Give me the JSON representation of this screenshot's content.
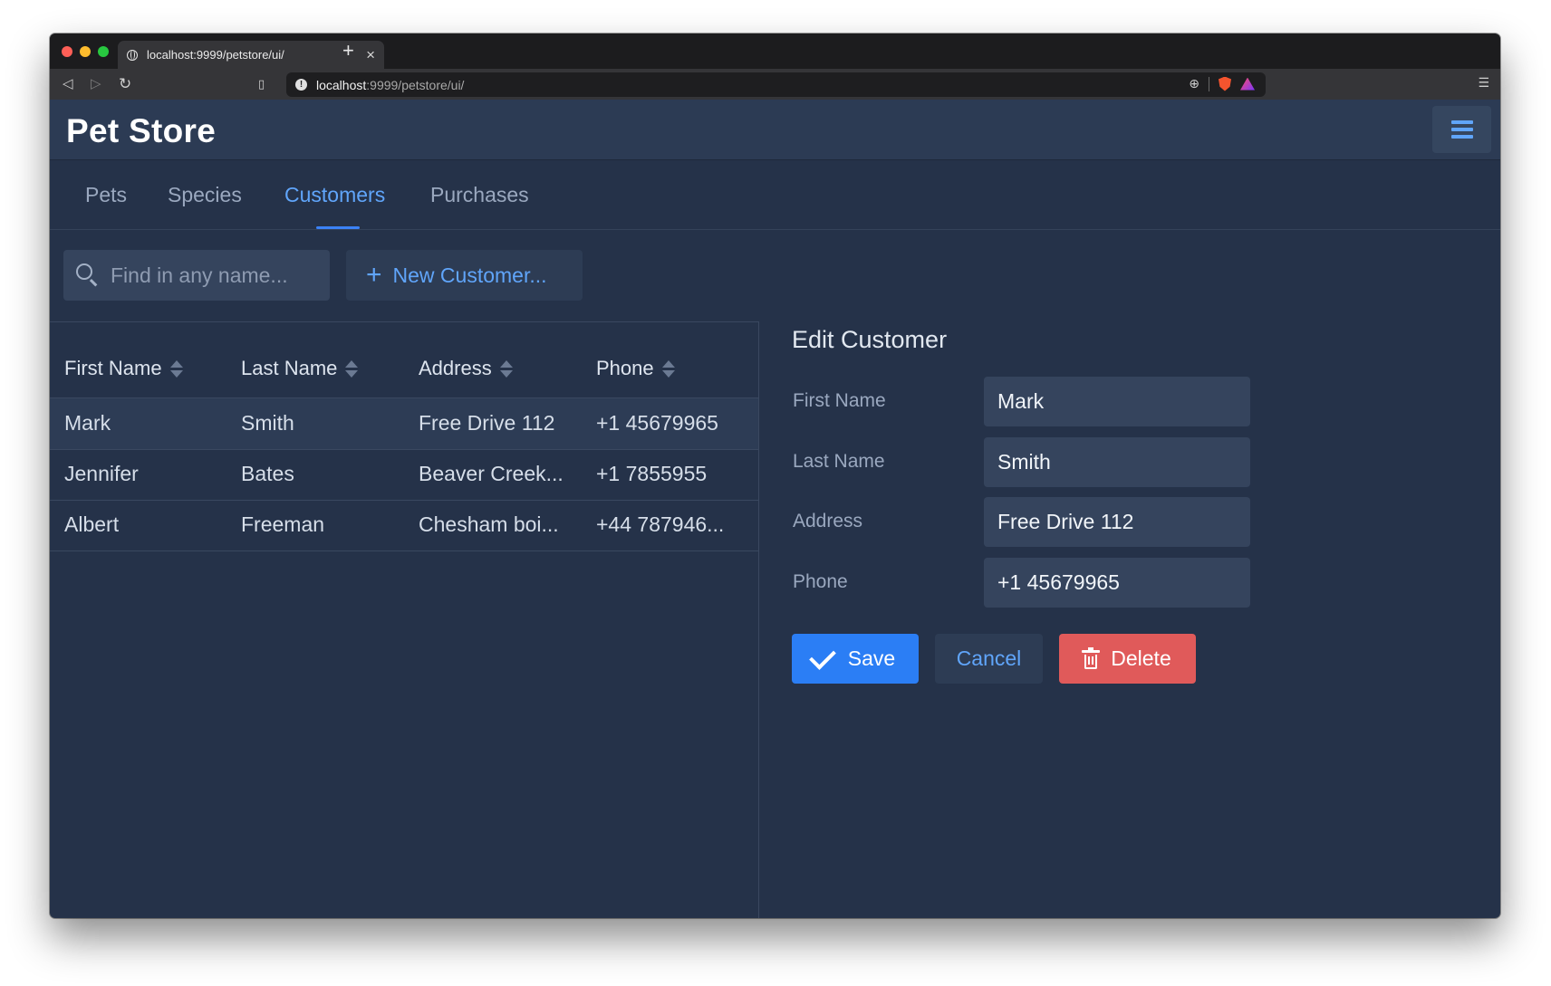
{
  "browser": {
    "tab_title": "localhost:9999/petstore/ui/",
    "tab_close": "×",
    "new_tab": "+",
    "url_host": "localhost",
    "url_rest": ":9999/petstore/ui/"
  },
  "app": {
    "title": "Pet Store"
  },
  "nav": {
    "tabs": [
      {
        "label": "Pets",
        "active": false
      },
      {
        "label": "Species",
        "active": false
      },
      {
        "label": "Customers",
        "active": true
      },
      {
        "label": "Purchases",
        "active": false
      }
    ]
  },
  "search": {
    "placeholder": "Find in any name...",
    "value": ""
  },
  "actions": {
    "new_customer_label": "New Customer...",
    "plus_glyph": "+"
  },
  "table": {
    "columns": [
      "First Name",
      "Last Name",
      "Address",
      "Phone"
    ],
    "rows": [
      {
        "first_name": "Mark",
        "last_name": "Smith",
        "address": "Free Drive 112",
        "phone": "+1 45679965",
        "selected": true
      },
      {
        "first_name": "Jennifer",
        "last_name": "Bates",
        "address": "Beaver Creek...",
        "phone": "+1 7855955",
        "selected": false
      },
      {
        "first_name": "Albert",
        "last_name": "Freeman",
        "address": "Chesham boi...",
        "phone": "+44 787946...",
        "selected": false
      }
    ]
  },
  "edit": {
    "title": "Edit Customer",
    "fields": [
      {
        "label": "First Name",
        "value": "Mark"
      },
      {
        "label": "Last Name",
        "value": "Smith"
      },
      {
        "label": "Address",
        "value": "Free Drive 112"
      },
      {
        "label": "Phone",
        "value": "+1 45679965"
      }
    ],
    "save_label": "Save",
    "cancel_label": "Cancel",
    "delete_label": "Delete"
  },
  "colors": {
    "background": "#253249",
    "header": "#2c3b54",
    "accent": "#60a5fa",
    "save": "#2b7ef5",
    "delete": "#e05a5a"
  }
}
